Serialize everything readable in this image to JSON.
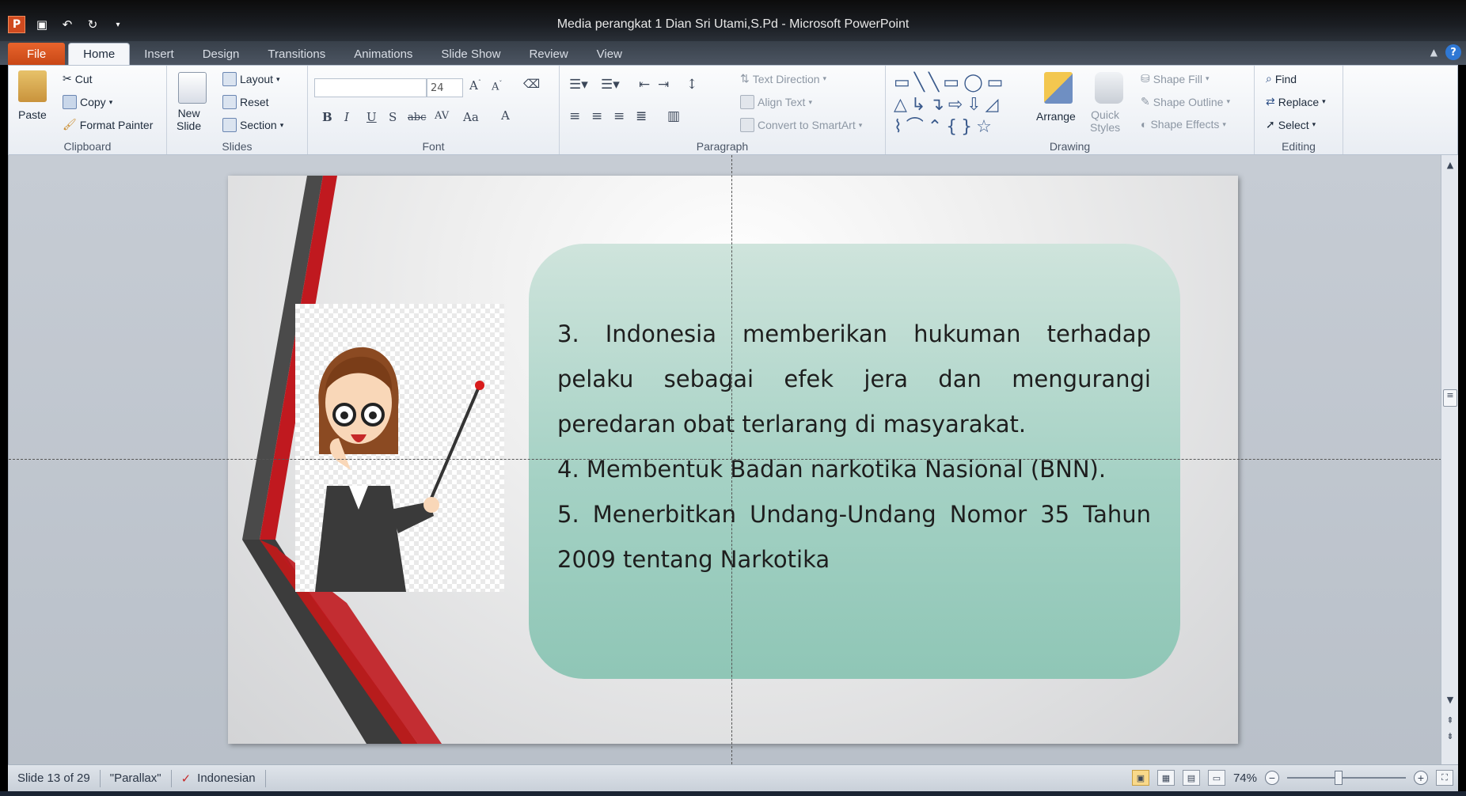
{
  "window": {
    "title": "Media perangkat 1 Dian Sri Utami,S.Pd  -  Microsoft PowerPoint"
  },
  "qat": {
    "app_icon": "P"
  },
  "tabs": [
    "File",
    "Home",
    "Insert",
    "Design",
    "Transitions",
    "Animations",
    "Slide Show",
    "Review",
    "View"
  ],
  "active_tab": "Home",
  "ribbon": {
    "clipboard": {
      "label": "Clipboard",
      "paste": "Paste",
      "cut": "Cut",
      "copy": "Copy",
      "format_painter": "Format Painter"
    },
    "slides": {
      "label": "Slides",
      "new_slide_1": "New",
      "new_slide_2": "Slide",
      "layout": "Layout",
      "reset": "Reset",
      "section": "Section"
    },
    "font": {
      "label": "Font",
      "font_name": "",
      "font_size": "24",
      "bold": "B",
      "italic": "I",
      "underline": "U",
      "shadow": "S",
      "strike": "abc",
      "spacing": "AV",
      "case": "Aa",
      "color": "A"
    },
    "paragraph": {
      "label": "Paragraph",
      "text_direction": "Text Direction",
      "align_text": "Align Text",
      "convert_smartart": "Convert to SmartArt"
    },
    "drawing": {
      "label": "Drawing",
      "arrange": "Arrange",
      "quick_styles_1": "Quick",
      "quick_styles_2": "Styles",
      "shape_fill": "Shape Fill",
      "shape_outline": "Shape Outline",
      "shape_effects": "Shape Effects"
    },
    "editing": {
      "label": "Editing",
      "find": "Find",
      "replace": "Replace",
      "select": "Select"
    }
  },
  "slide": {
    "p1": "3. Indonesia memberikan hukuman terhadap pelaku sebagai efek jera dan mengurangi peredaran obat terlarang di masyarakat.",
    "p2": "4. Membentuk Badan narkotika Nasional (BNN).",
    "p3": "5. Menerbitkan Undang-Undang Nomor 35 Tahun 2009 tentang Narkotika"
  },
  "status": {
    "slide_counter": "Slide 13 of 29",
    "theme": "\"Parallax\"",
    "language": "Indonesian",
    "zoom": "74%"
  },
  "colors": {
    "file_tab": "#d8501e",
    "textbox": "#a4d1c4",
    "ribbon_red": "#c0191f"
  }
}
